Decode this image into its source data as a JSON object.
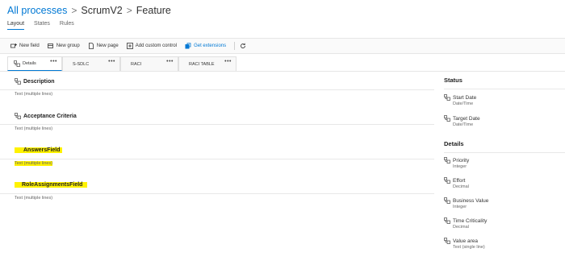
{
  "breadcrumb": {
    "root": "All processes",
    "process": "ScrumV2",
    "item": "Feature"
  },
  "top_tabs": [
    {
      "label": "Layout",
      "active": true
    },
    {
      "label": "States",
      "active": false
    },
    {
      "label": "Rules",
      "active": false
    }
  ],
  "toolbar": {
    "new_field": "New field",
    "new_group": "New group",
    "new_page": "New page",
    "add_custom_control": "Add custom control",
    "get_extensions": "Get extensions"
  },
  "page_tabs": [
    {
      "label": "Details",
      "active": true
    },
    {
      "label": "S-SDLC",
      "active": false
    },
    {
      "label": "RACI",
      "active": false
    },
    {
      "label": "RACI TABLE",
      "active": false
    }
  ],
  "main_groups": [
    {
      "title": "Description",
      "type": "Text (multiple lines)"
    },
    {
      "title": "Acceptance Criteria",
      "type": "Text (multiple lines)"
    },
    {
      "title": "AnswersField",
      "type": "Text (multiple lines)"
    },
    {
      "title": "RoleAssignmentsField",
      "type": "Text (multiple lines)"
    }
  ],
  "side": {
    "status_title": "Status",
    "status_fields": [
      {
        "name": "Start Date",
        "type": "Date/Time"
      },
      {
        "name": "Target Date",
        "type": "Date/Time"
      }
    ],
    "details_title": "Details",
    "details_fields": [
      {
        "name": "Priority",
        "type": "Integer"
      },
      {
        "name": "Effort",
        "type": "Decimal"
      },
      {
        "name": "Business Value",
        "type": "Integer"
      },
      {
        "name": "Time Criticality",
        "type": "Decimal"
      },
      {
        "name": "Value area",
        "type": "Text (single line)"
      }
    ]
  },
  "colors": {
    "accent": "#0078d4",
    "highlight": "#fff200"
  }
}
